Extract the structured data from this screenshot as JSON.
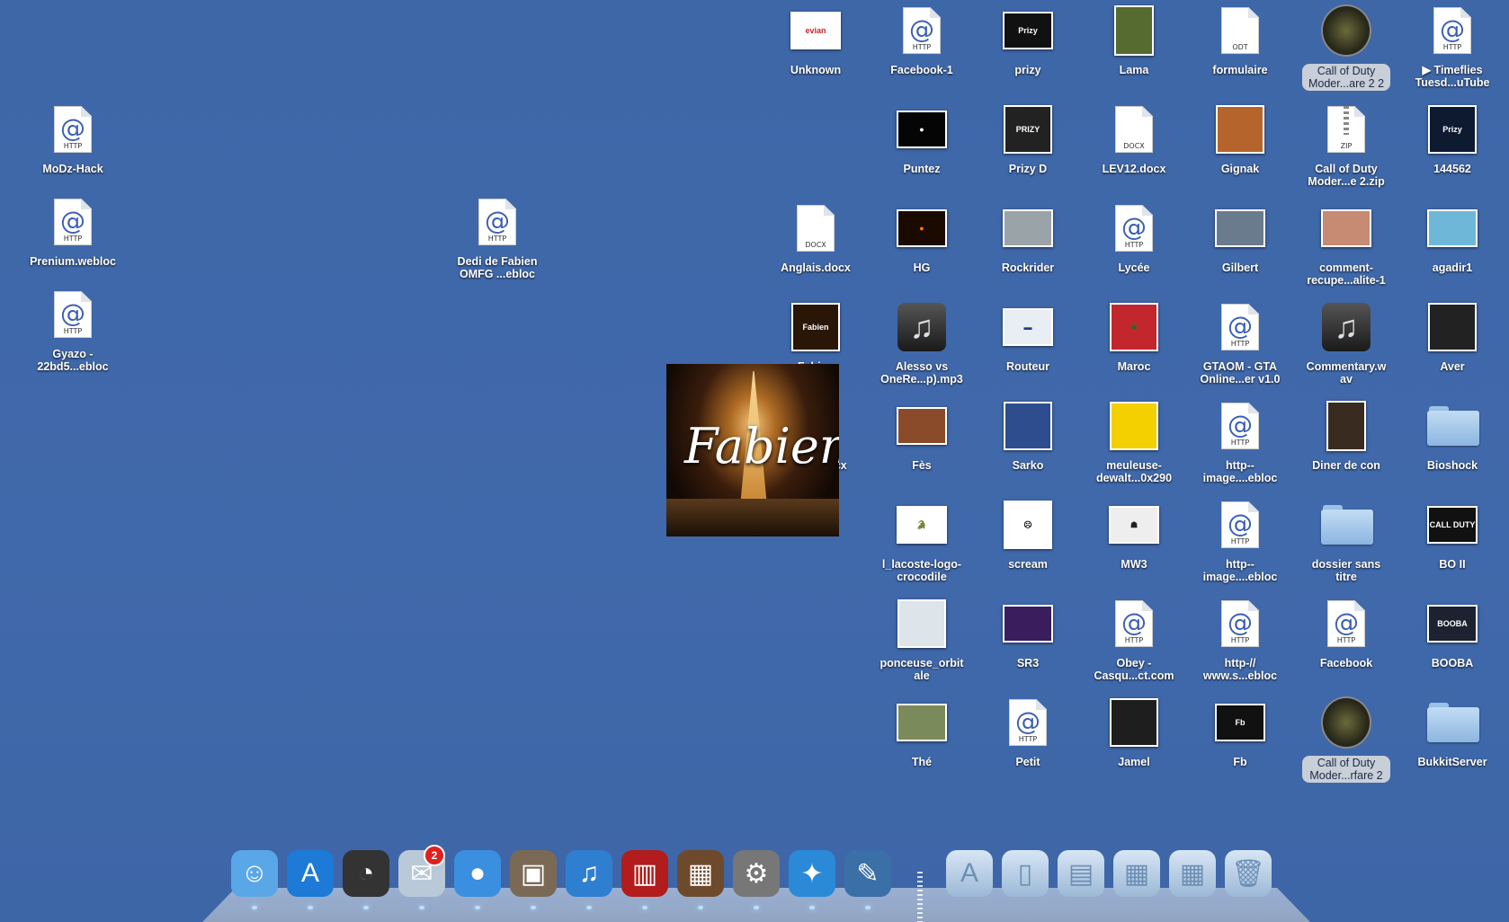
{
  "desktop": {
    "left_items": [
      {
        "label": "MoDz-Hack",
        "kind": "webloc"
      },
      {
        "label": "Prenium.webloc",
        "kind": "webloc"
      },
      {
        "label": "Gyazo -\n22bd5...ebloc",
        "kind": "webloc"
      },
      {
        "label": "Dedi de Fabien\nOMFG ...ebloc",
        "kind": "webloc"
      }
    ],
    "grid": [
      {
        "label": "Unknown",
        "kind": "thumb",
        "color": "#ffffff",
        "text": "evian",
        "textColor": "#d0202a"
      },
      {
        "label": "Facebook-1",
        "kind": "webloc"
      },
      {
        "label": "prizy",
        "kind": "thumb",
        "color": "#111111",
        "text": "Prizy"
      },
      {
        "label": "Lama",
        "kind": "thumb",
        "color": "#556b2f",
        "tall": true
      },
      {
        "label": "formulaire",
        "kind": "doc",
        "ext": "ODT"
      },
      {
        "label": "Call of Duty\nModer...are 2 2",
        "kind": "cod",
        "selected": true
      },
      {
        "label": "▶ Timeflies\nTuesd...uTube",
        "kind": "webloc"
      },
      {
        "label": "Puntez",
        "kind": "thumb",
        "color": "#050505",
        "text": "●"
      },
      {
        "label": "Prizy D",
        "kind": "thumb",
        "color": "#222222",
        "text": "PRIZY",
        "sq": true
      },
      {
        "label": "LEV12.docx",
        "kind": "doc",
        "ext": "DOCX"
      },
      {
        "label": "Gignak",
        "kind": "thumb",
        "color": "#b5652b",
        "sq": true
      },
      {
        "label": "Call of Duty\nModer...e 2.zip",
        "kind": "zip"
      },
      {
        "label": "144562",
        "kind": "thumb",
        "color": "#0d1a30",
        "text": "Prizy",
        "sq": true
      },
      {
        "label": "Anglais.docx",
        "kind": "doc",
        "ext": "DOCX"
      },
      {
        "label": "HG",
        "kind": "thumb",
        "color": "#1a0a00",
        "text": "●",
        "textColor": "#ff7a00"
      },
      {
        "label": "Rockrider",
        "kind": "thumb",
        "color": "#9aa3a8"
      },
      {
        "label": "Lycée",
        "kind": "webloc"
      },
      {
        "label": "Gilbert",
        "kind": "thumb",
        "color": "#6b7b8e"
      },
      {
        "label": "comment-\nrecupe...alite-1",
        "kind": "thumb",
        "color": "#c78a73"
      },
      {
        "label": "agadir1",
        "kind": "thumb",
        "color": "#6fb7d9"
      },
      {
        "label": "Fabien",
        "kind": "thumb",
        "color": "#2a1607",
        "text": "Fabien",
        "sq": true
      },
      {
        "label": "Alesso vs\nOneRe...p).mp3",
        "kind": "music"
      },
      {
        "label": "Routeur",
        "kind": "thumb",
        "color": "#e8eef4",
        "text": "▬",
        "textColor": "#243a8a"
      },
      {
        "label": "Maroc",
        "kind": "thumb",
        "color": "#c2272d",
        "text": "★",
        "textColor": "#1f6b2f",
        "sq": true
      },
      {
        "label": "GTAOM - GTA\nOnline...er v1.0",
        "kind": "webloc"
      },
      {
        "label": "Commentary.w\nav",
        "kind": "music"
      },
      {
        "label": "Aver",
        "kind": "thumb",
        "color": "#222222",
        "sq": true
      },
      {
        "label": "Maroc.docx",
        "kind": "doc",
        "ext": "DOCX"
      },
      {
        "label": "Fès",
        "kind": "thumb",
        "color": "#8a4b2a"
      },
      {
        "label": "Sarko",
        "kind": "thumb",
        "color": "#2e4d8e",
        "sq": true
      },
      {
        "label": "meuleuse-\ndewalt...0x290",
        "kind": "thumb",
        "color": "#f5d000",
        "sq": true
      },
      {
        "label": "http--\nimage....ebloc",
        "kind": "webloc"
      },
      {
        "label": "Diner de con",
        "kind": "thumb",
        "color": "#3a2b20",
        "tall": true
      },
      {
        "label": "Bioshock",
        "kind": "folder"
      },
      {
        "label": "l_lacoste-logo-\ncrocodile",
        "kind": "thumb",
        "color": "#ffffff",
        "text": "🐊",
        "textColor": "#1c7a3a"
      },
      {
        "label": "scream",
        "kind": "thumb",
        "color": "#ffffff",
        "text": "☹",
        "textColor": "#000000",
        "sq": true
      },
      {
        "label": "MW3",
        "kind": "thumb",
        "color": "#eeeeee",
        "text": "☗",
        "textColor": "#222222"
      },
      {
        "label": "http--\nimage....ebloc",
        "kind": "webloc"
      },
      {
        "label": "dossier sans\ntitre",
        "kind": "folder"
      },
      {
        "label": "BO II",
        "kind": "thumb",
        "color": "#111111",
        "text": "CALL DUTY"
      },
      {
        "label": "ponceuse_orbit\nale",
        "kind": "thumb",
        "color": "#dde4ea",
        "sq": true
      },
      {
        "label": "SR3",
        "kind": "thumb",
        "color": "#3a1d5c"
      },
      {
        "label": "Obey -\nCasqu...ct.com",
        "kind": "webloc"
      },
      {
        "label": "http-//\nwww.s...ebloc",
        "kind": "webloc"
      },
      {
        "label": "Facebook",
        "kind": "webloc"
      },
      {
        "label": "BOOBA",
        "kind": "thumb",
        "color": "#1c2230",
        "text": "BOOBA"
      },
      {
        "label": "Thé",
        "kind": "thumb",
        "color": "#7a8a5a"
      },
      {
        "label": "Petit",
        "kind": "webloc"
      },
      {
        "label": "Jamel",
        "kind": "thumb",
        "color": "#1e1e1e",
        "sq": true
      },
      {
        "label": "Fb",
        "kind": "thumb",
        "color": "#111111",
        "text": "Fb"
      },
      {
        "label": "Call of Duty\nModer...rfare 2",
        "kind": "cod",
        "selected": true
      },
      {
        "label": "BukkitServer",
        "kind": "folder"
      }
    ],
    "drag_preview": {
      "script_text": "Fabien"
    }
  },
  "dock": {
    "apps": [
      {
        "name": "finder",
        "glyph": "☺",
        "color": "#5aa7e8"
      },
      {
        "name": "app-store",
        "glyph": "A",
        "color": "#1d7ad6"
      },
      {
        "name": "dashboard",
        "glyph": "◔",
        "color": "#333333"
      },
      {
        "name": "mail",
        "glyph": "✉",
        "color": "#b9c9d8",
        "badge": "2"
      },
      {
        "name": "facetime",
        "glyph": "●",
        "color": "#3b8fe0"
      },
      {
        "name": "preview",
        "glyph": "▣",
        "color": "#7a6a55"
      },
      {
        "name": "itunes",
        "glyph": "♫",
        "color": "#2f7fd1"
      },
      {
        "name": "photo-booth",
        "glyph": "▥",
        "color": "#b21c1c"
      },
      {
        "name": "iphoto",
        "glyph": "▦",
        "color": "#6e4a2c"
      },
      {
        "name": "system-preferences",
        "glyph": "⚙",
        "color": "#777777"
      },
      {
        "name": "safari",
        "glyph": "✦",
        "color": "#2a8ad8"
      },
      {
        "name": "xcode",
        "glyph": "✎",
        "color": "#3a6fa8"
      }
    ],
    "stacks": [
      {
        "name": "applications-stack",
        "glyph": "A"
      },
      {
        "name": "documents-stack",
        "glyph": "▯"
      },
      {
        "name": "downloads-stack",
        "glyph": "▤"
      },
      {
        "name": "screenshot-stack-1",
        "glyph": "▦"
      },
      {
        "name": "screenshot-stack-2",
        "glyph": "▦"
      },
      {
        "name": "trash",
        "glyph": "🗑"
      }
    ]
  }
}
